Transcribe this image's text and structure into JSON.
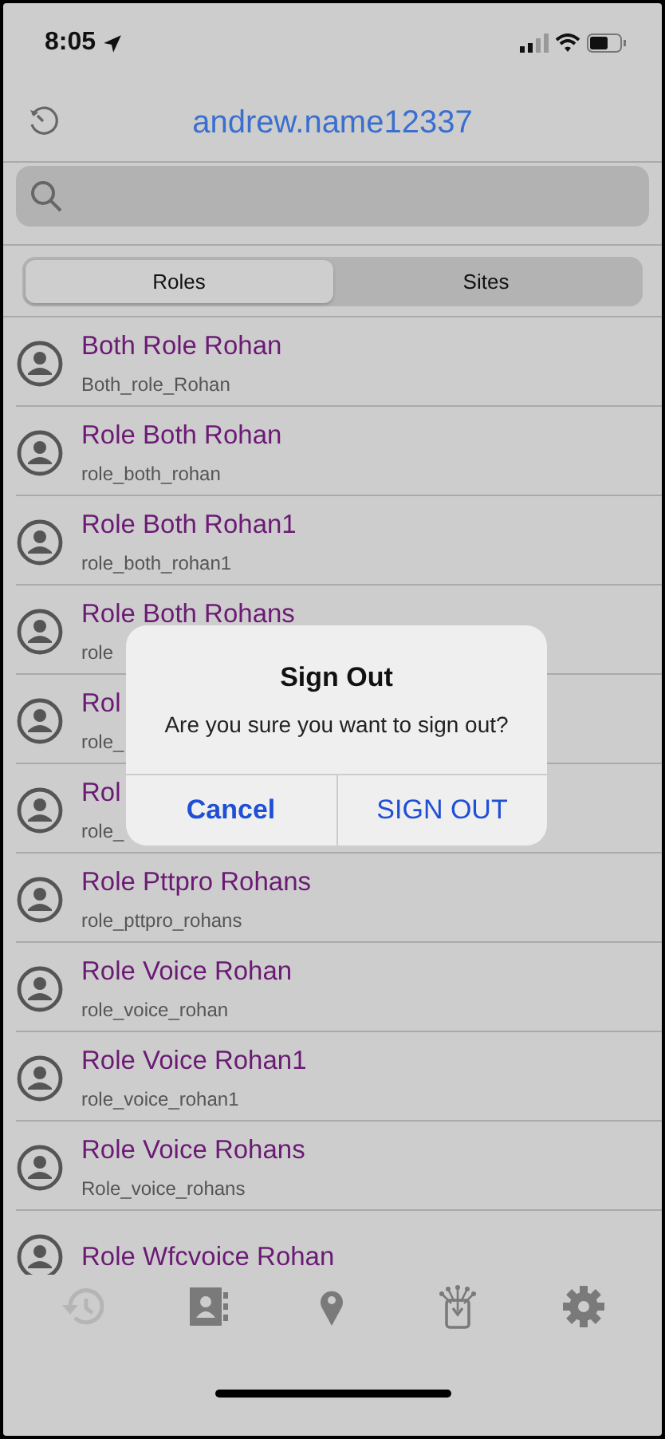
{
  "status_bar": {
    "time": "8:05"
  },
  "header": {
    "title": "andrew.name12337"
  },
  "segments": [
    {
      "label": "Roles",
      "selected": true
    },
    {
      "label": "Sites",
      "selected": false
    }
  ],
  "roles": [
    {
      "name": "Both Role Rohan",
      "id": "Both_role_Rohan"
    },
    {
      "name": "Role Both Rohan",
      "id": "role_both_rohan"
    },
    {
      "name": "Role Both Rohan1",
      "id": "role_both_rohan1"
    },
    {
      "name": "Role Both Rohans",
      "id": "role"
    },
    {
      "name": "Rol",
      "id": "role_"
    },
    {
      "name": "Rol",
      "id": "role_"
    },
    {
      "name": "Role Pttpro Rohans",
      "id": "role_pttpro_rohans"
    },
    {
      "name": "Role Voice Rohan",
      "id": "role_voice_rohan"
    },
    {
      "name": "Role Voice Rohan1",
      "id": "role_voice_rohan1"
    },
    {
      "name": "Role Voice Rohans",
      "id": "Role_voice_rohans"
    },
    {
      "name": "Role Wfcvoice Rohan"
    }
  ],
  "tab_bar": [
    {
      "kind": "history",
      "disabled": true
    },
    {
      "kind": "contacts",
      "disabled": false
    },
    {
      "kind": "location",
      "disabled": false
    },
    {
      "kind": "device",
      "disabled": false
    },
    {
      "kind": "settings",
      "disabled": false
    }
  ],
  "dialog": {
    "title": "Sign Out",
    "message": "Are you sure you want to sign out?",
    "buttons": [
      {
        "label": "Cancel",
        "kind": "cancel"
      },
      {
        "label": "SIGN OUT",
        "kind": "default"
      }
    ]
  }
}
